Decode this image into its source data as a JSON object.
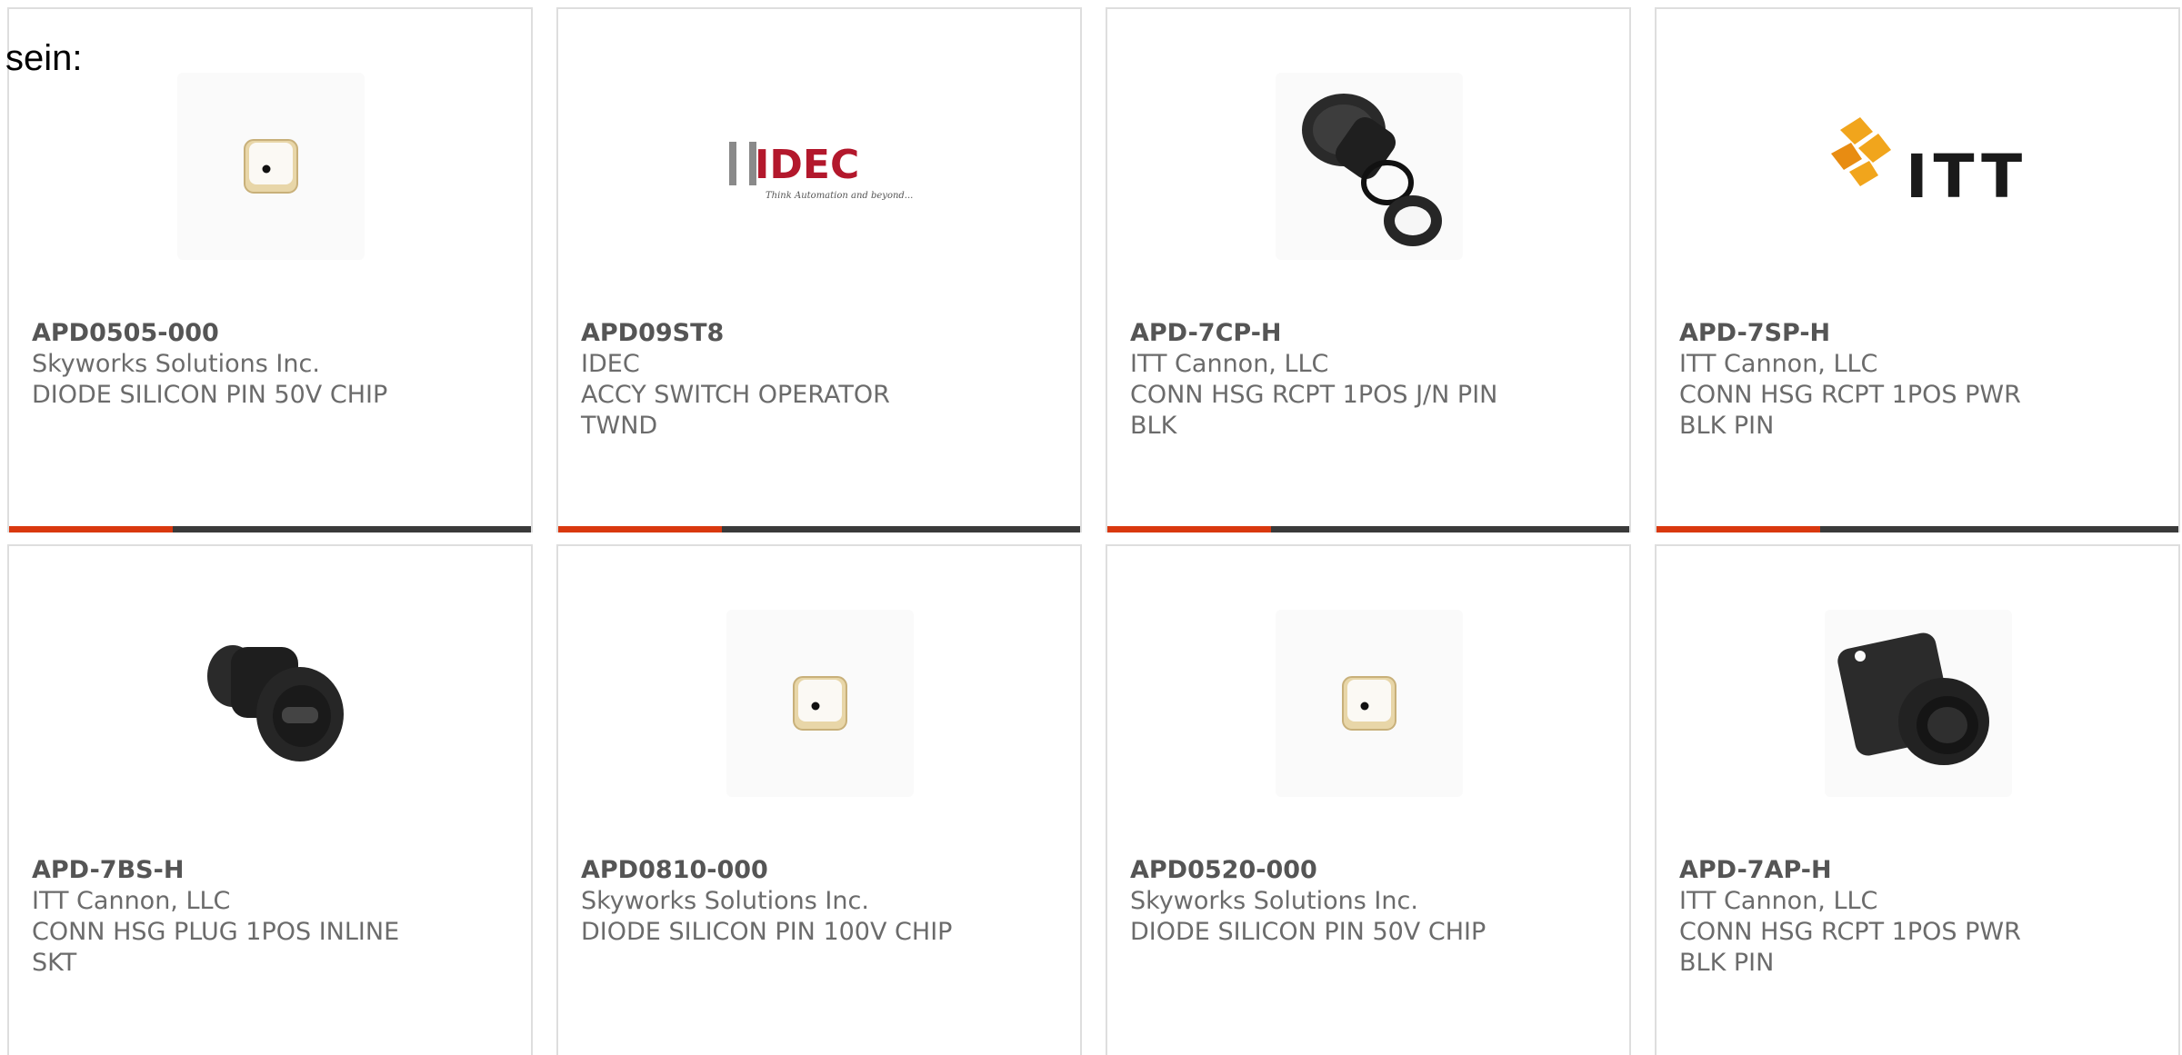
{
  "intro_text": "sein:",
  "colors": {
    "accent": "#d9380f",
    "bar": "#3a3a3a",
    "border": "#dedede",
    "text": "#6b6b6b"
  },
  "products": [
    {
      "part": "APD0505-000",
      "manufacturer": "Skyworks Solutions Inc.",
      "description": "DIODE SILICON PIN 50V CHIP",
      "image": "diode-chip-image"
    },
    {
      "part": "APD09ST8",
      "manufacturer": "IDEC",
      "description": "ACCY SWITCH OPERATOR TWND",
      "image": "idec-logo",
      "logo_text": "IDEC",
      "logo_tagline": "Think Automation and beyond..."
    },
    {
      "part": "APD-7CP-H",
      "manufacturer": "ITT Cannon, LLC",
      "description": "CONN HSG RCPT 1POS J/N PIN BLK",
      "image": "connector-receptacle-kit-image"
    },
    {
      "part": "APD-7SP-H",
      "manufacturer": "ITT Cannon, LLC",
      "description": "CONN HSG RCPT 1POS PWR BLK PIN",
      "image": "itt-logo",
      "logo_text": "ITT"
    },
    {
      "part": "APD-7BS-H",
      "manufacturer": "ITT Cannon, LLC",
      "description": "CONN HSG PLUG 1POS INLINE SKT",
      "image": "connector-plug-image"
    },
    {
      "part": "APD0810-000",
      "manufacturer": "Skyworks Solutions Inc.",
      "description": "DIODE SILICON PIN 100V CHIP",
      "image": "diode-chip-image"
    },
    {
      "part": "APD0520-000",
      "manufacturer": "Skyworks Solutions Inc.",
      "description": "DIODE SILICON PIN 50V CHIP",
      "image": "diode-chip-image"
    },
    {
      "part": "APD-7AP-H",
      "manufacturer": "ITT Cannon, LLC",
      "description": "CONN HSG RCPT 1POS PWR BLK PIN",
      "image": "connector-flange-receptacle-image"
    }
  ]
}
